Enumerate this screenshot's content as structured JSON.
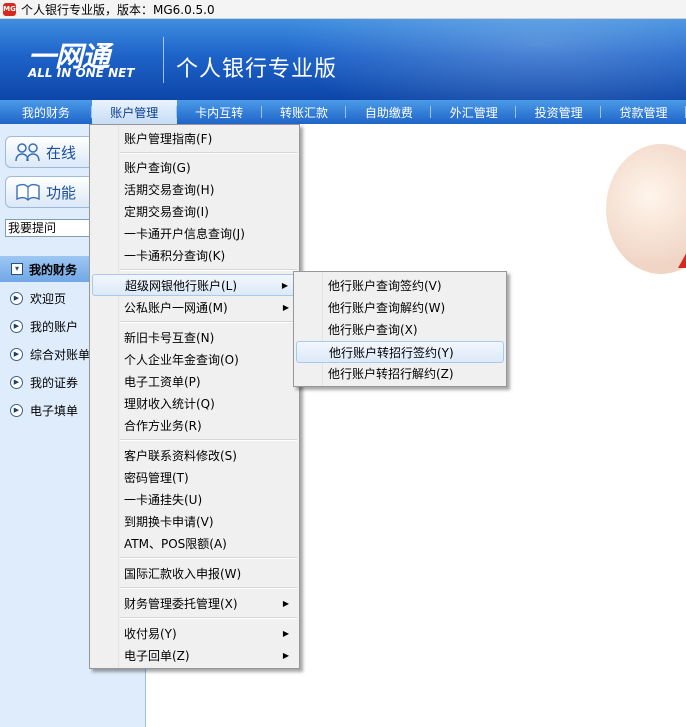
{
  "window": {
    "title": "个人银行专业版，版本：MG6.0.5.0",
    "app_icon": "MG"
  },
  "banner": {
    "logo_text": "一网通",
    "logo_subtitle": "ALL IN ONE NET",
    "product_name": "个人银行专业版"
  },
  "nav": {
    "items": [
      "我的财务",
      "账户管理",
      "卡内互转",
      "转账汇款",
      "自助缴费",
      "外汇管理",
      "投资管理",
      "贷款管理"
    ],
    "active_index": 1
  },
  "sidebar": {
    "online_label": "在线",
    "function_label": "功能",
    "ask_label": "我要提问",
    "section_title": "我的财务",
    "items": [
      "欢迎页",
      "我的账户",
      "综合对账单",
      "我的证券",
      "电子填单"
    ]
  },
  "account_menu": {
    "items": [
      "账户管理指南(F)",
      "账户查询(G)",
      "活期交易查询(H)",
      "定期交易查询(I)",
      "一卡通开户信息查询(J)",
      "一卡通积分查询(K)",
      "超级网银他行账户(L)",
      "公私账户一网通(M)",
      "新旧卡号互查(N)",
      "个人企业年金查询(O)",
      "电子工资单(P)",
      "理财收入统计(Q)",
      "合作方业务(R)",
      "客户联系资料修改(S)",
      "密码管理(T)",
      "一卡通挂失(U)",
      "到期换卡申请(V)",
      "ATM、POS限额(A)",
      "国际汇款收入申报(W)",
      "财务管理委托管理(X)",
      "收付易(Y)",
      "电子回单(Z)"
    ]
  },
  "other_bank_submenu": {
    "items": [
      "他行账户查询签约(V)",
      "他行账户查询解约(W)",
      "他行账户查询(X)",
      "他行账户转招行签约(Y)",
      "他行账户转招行解约(Z)"
    ],
    "highlighted_index": 3
  },
  "colors": {
    "banner": "#1e63c9",
    "nav": "#2f7ad6",
    "sidebar": "#dfecfb",
    "accent_red": "#d8281e"
  }
}
